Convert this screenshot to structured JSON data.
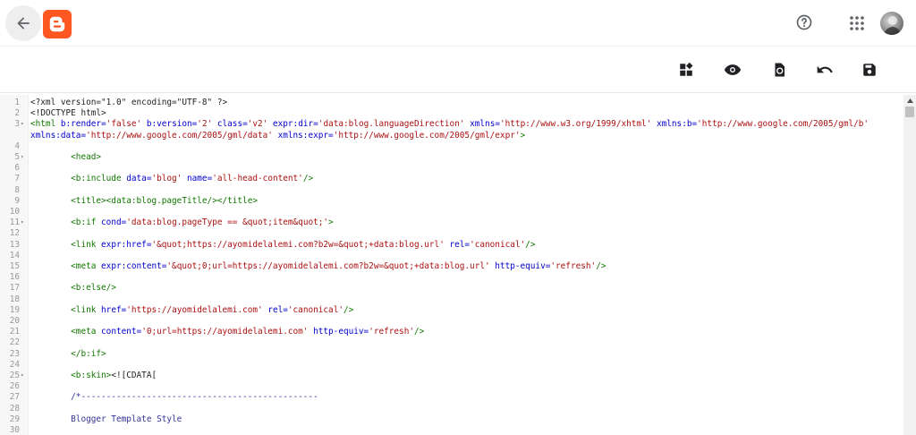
{
  "header": {
    "back_icon": "arrow-back-icon",
    "logo_icon": "blogger-logo-icon",
    "help_icon": "help-circle-icon",
    "apps_icon": "apps-grid-icon",
    "avatar_icon": "account-avatar",
    "accent_color": "#ff5722"
  },
  "toolbar": {
    "icons": [
      "jump-to-widget-icon",
      "preview-icon",
      "restore-icon",
      "undo-icon",
      "save-icon"
    ]
  },
  "editor": {
    "lines": [
      {
        "n": "1",
        "fold": "",
        "tokens": [
          [
            "t-plain",
            "<?xml version=\"1.0\" encoding=\"UTF-8\" ?>"
          ]
        ]
      },
      {
        "n": "2",
        "fold": "",
        "tokens": [
          [
            "t-plain",
            "<!DOCTYPE html>"
          ]
        ]
      },
      {
        "n": "3",
        "fold": "▾",
        "tokens": [
          [
            "t-tag",
            "<html "
          ],
          [
            "t-attr",
            "b:render="
          ],
          [
            "t-str",
            "'false' "
          ],
          [
            "t-attr",
            "b:version="
          ],
          [
            "t-str",
            "'2' "
          ],
          [
            "t-attr",
            "class="
          ],
          [
            "t-str",
            "'v2' "
          ],
          [
            "t-attr",
            "expr:dir="
          ],
          [
            "t-str",
            "'data:blog.languageDirection' "
          ],
          [
            "t-attr",
            "xmlns="
          ],
          [
            "t-str",
            "'http://www.w3.org/1999/xhtml' "
          ],
          [
            "t-attr",
            "xmlns:b="
          ],
          [
            "t-str",
            "'http://www.google.com/2005/gml/b'"
          ]
        ]
      },
      {
        "n": "",
        "fold": "",
        "tokens": [
          [
            "t-attr",
            "xmlns:data="
          ],
          [
            "t-str",
            "'http://www.google.com/2005/gml/data' "
          ],
          [
            "t-attr",
            "xmlns:expr="
          ],
          [
            "t-str",
            "'http://www.google.com/2005/gml/expr'"
          ],
          [
            "t-tag",
            ">"
          ]
        ]
      },
      {
        "n": "4",
        "fold": "",
        "tokens": []
      },
      {
        "n": "5",
        "fold": "▾",
        "tokens": [
          [
            "t-plain",
            "        "
          ],
          [
            "t-tag",
            "<head>"
          ]
        ]
      },
      {
        "n": "6",
        "fold": "",
        "tokens": []
      },
      {
        "n": "7",
        "fold": "",
        "tokens": [
          [
            "t-plain",
            "        "
          ],
          [
            "t-tag",
            "<b:include "
          ],
          [
            "t-attr",
            "data="
          ],
          [
            "t-str",
            "'blog' "
          ],
          [
            "t-attr",
            "name="
          ],
          [
            "t-str",
            "'all-head-content'"
          ],
          [
            "t-tag",
            "/>"
          ]
        ]
      },
      {
        "n": "8",
        "fold": "",
        "tokens": []
      },
      {
        "n": "9",
        "fold": "",
        "tokens": [
          [
            "t-plain",
            "        "
          ],
          [
            "t-tag",
            "<title><data:blog.pageTitle/></title>"
          ]
        ]
      },
      {
        "n": "10",
        "fold": "",
        "tokens": []
      },
      {
        "n": "11",
        "fold": "▾",
        "tokens": [
          [
            "t-plain",
            "        "
          ],
          [
            "t-tag",
            "<b:if "
          ],
          [
            "t-attr",
            "cond="
          ],
          [
            "t-str",
            "'data:blog.pageType == &quot;item&quot;'"
          ],
          [
            "t-tag",
            ">"
          ]
        ]
      },
      {
        "n": "12",
        "fold": "",
        "tokens": []
      },
      {
        "n": "13",
        "fold": "",
        "tokens": [
          [
            "t-plain",
            "        "
          ],
          [
            "t-tag",
            "<link "
          ],
          [
            "t-attr",
            "expr:href="
          ],
          [
            "t-str",
            "'&quot;https://ayomidelalemi.com?b2w=&quot;+data:blog.url' "
          ],
          [
            "t-attr",
            "rel="
          ],
          [
            "t-str",
            "'canonical'"
          ],
          [
            "t-tag",
            "/>"
          ]
        ]
      },
      {
        "n": "14",
        "fold": "",
        "tokens": []
      },
      {
        "n": "15",
        "fold": "",
        "tokens": [
          [
            "t-plain",
            "        "
          ],
          [
            "t-tag",
            "<meta "
          ],
          [
            "t-attr",
            "expr:content="
          ],
          [
            "t-str",
            "'&quot;0;url=https://ayomidelalemi.com?b2w=&quot;+data:blog.url' "
          ],
          [
            "t-attr",
            "http-equiv="
          ],
          [
            "t-str",
            "'refresh'"
          ],
          [
            "t-tag",
            "/>"
          ]
        ]
      },
      {
        "n": "16",
        "fold": "",
        "tokens": []
      },
      {
        "n": "17",
        "fold": "",
        "tokens": [
          [
            "t-plain",
            "        "
          ],
          [
            "t-tag",
            "<b:else/>"
          ]
        ]
      },
      {
        "n": "18",
        "fold": "",
        "tokens": []
      },
      {
        "n": "19",
        "fold": "",
        "tokens": [
          [
            "t-plain",
            "        "
          ],
          [
            "t-tag",
            "<link "
          ],
          [
            "t-attr",
            "href="
          ],
          [
            "t-str",
            "'https://ayomidelalemi.com' "
          ],
          [
            "t-attr",
            "rel="
          ],
          [
            "t-str",
            "'canonical'"
          ],
          [
            "t-tag",
            "/>"
          ]
        ]
      },
      {
        "n": "20",
        "fold": "",
        "tokens": []
      },
      {
        "n": "21",
        "fold": "",
        "tokens": [
          [
            "t-plain",
            "        "
          ],
          [
            "t-tag",
            "<meta "
          ],
          [
            "t-attr",
            "content="
          ],
          [
            "t-str",
            "'0;url=https://ayomidelalemi.com' "
          ],
          [
            "t-attr",
            "http-equiv="
          ],
          [
            "t-str",
            "'refresh'"
          ],
          [
            "t-tag",
            "/>"
          ]
        ]
      },
      {
        "n": "22",
        "fold": "",
        "tokens": []
      },
      {
        "n": "23",
        "fold": "",
        "tokens": [
          [
            "t-plain",
            "        "
          ],
          [
            "t-tag",
            "</b:if>"
          ]
        ]
      },
      {
        "n": "24",
        "fold": "",
        "tokens": []
      },
      {
        "n": "25",
        "fold": "▾",
        "tokens": [
          [
            "t-plain",
            "        "
          ],
          [
            "t-tag",
            "<b:skin>"
          ],
          [
            "t-plain",
            "<![CDATA["
          ]
        ]
      },
      {
        "n": "26",
        "fold": "",
        "tokens": []
      },
      {
        "n": "27",
        "fold": "",
        "tokens": [
          [
            "t-plain",
            "        "
          ],
          [
            "t-comment",
            "/*-----------------------------------------------"
          ]
        ]
      },
      {
        "n": "28",
        "fold": "",
        "tokens": []
      },
      {
        "n": "29",
        "fold": "",
        "tokens": [
          [
            "t-plain",
            "        "
          ],
          [
            "t-comment",
            "Blogger Template Style"
          ]
        ]
      },
      {
        "n": "30",
        "fold": "",
        "tokens": []
      }
    ]
  }
}
